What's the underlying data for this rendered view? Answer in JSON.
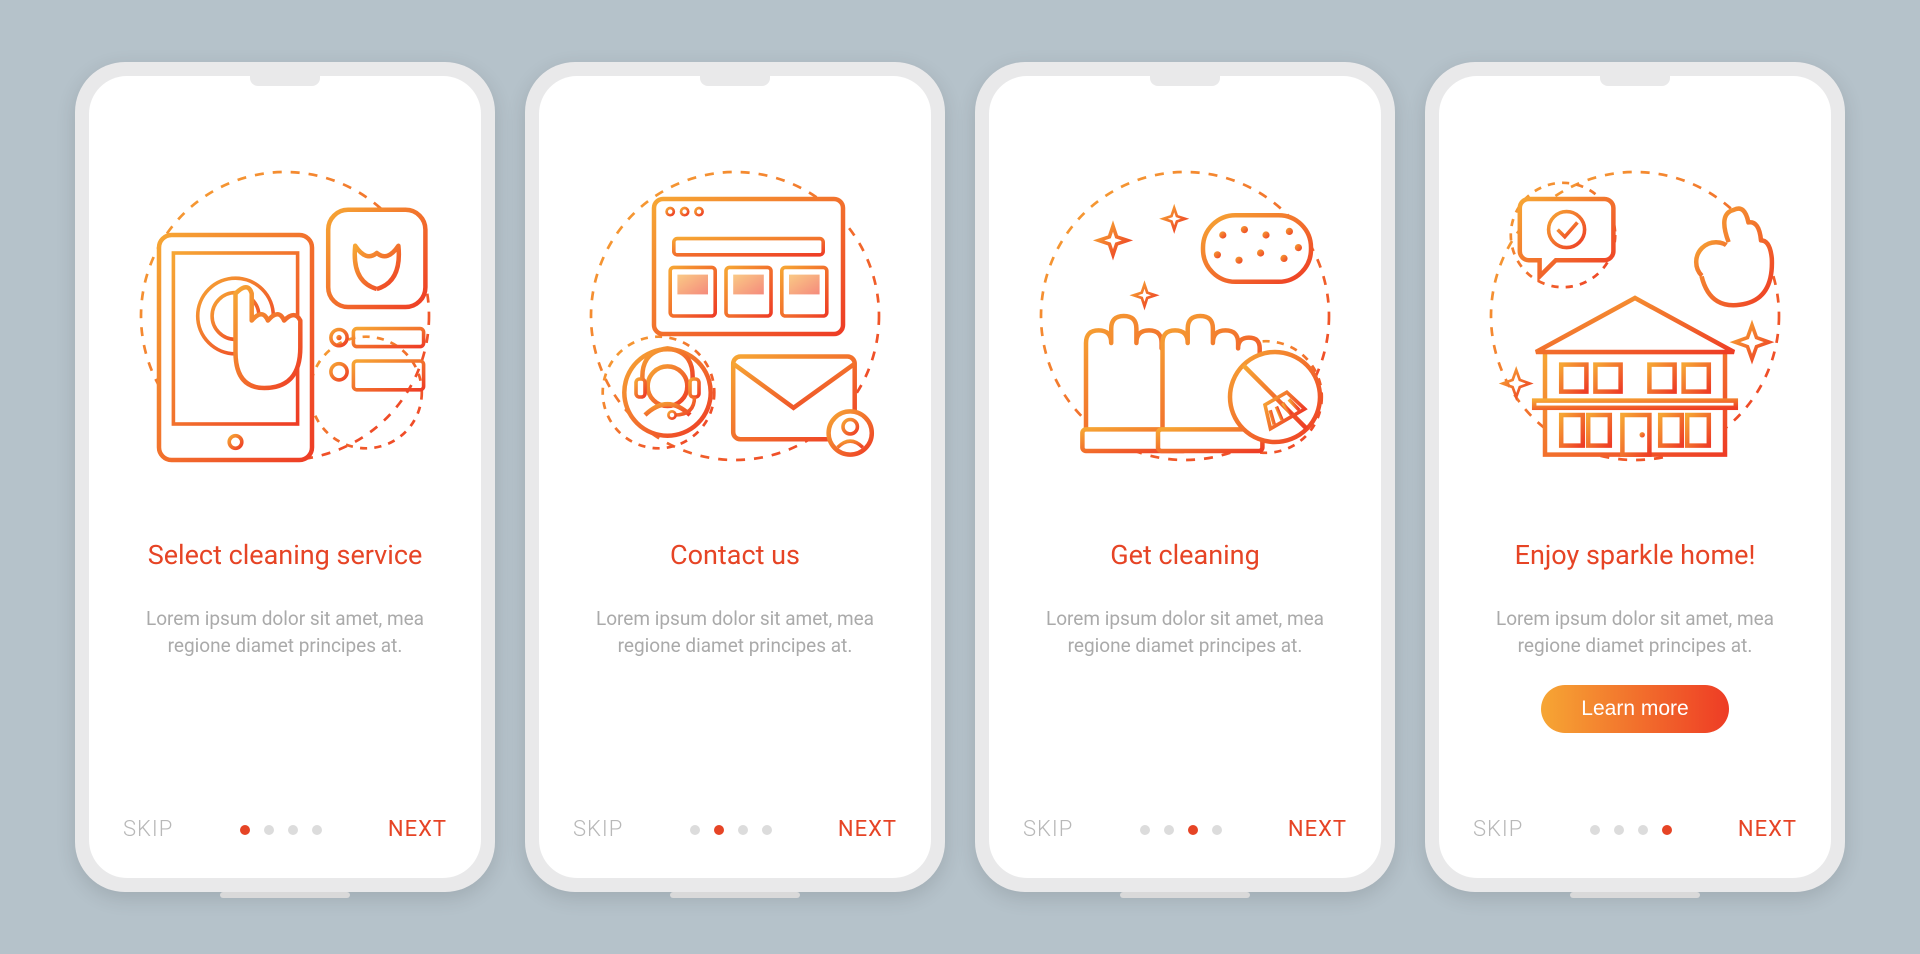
{
  "brand": {
    "accent": "#e64425",
    "gradient_start": "#f6a634",
    "gradient_end": "#ee3c25",
    "muted": "#aaaaaa",
    "inactive_dot": "#dcdcdc"
  },
  "nav": {
    "skip_label": "SKIP",
    "next_label": "NEXT"
  },
  "cta": {
    "label": "Learn more"
  },
  "screens": [
    {
      "title": "Select cleaning service",
      "desc": "Lorem ipsum dolor sit amet, mea regione diamet principes at.",
      "active_dot": 0,
      "illustration": "select-service-icon",
      "has_cta": false
    },
    {
      "title": "Contact us",
      "desc": "Lorem ipsum dolor sit amet, mea regione diamet principes at.",
      "active_dot": 1,
      "illustration": "contact-us-icon",
      "has_cta": false
    },
    {
      "title": "Get cleaning",
      "desc": "Lorem ipsum dolor sit amet, mea regione diamet principes at.",
      "active_dot": 2,
      "illustration": "get-cleaning-icon",
      "has_cta": false
    },
    {
      "title": "Enjoy sparkle home!",
      "desc": "Lorem ipsum dolor sit amet, mea regione diamet principes at.",
      "active_dot": 3,
      "illustration": "sparkle-home-icon",
      "has_cta": true
    }
  ]
}
